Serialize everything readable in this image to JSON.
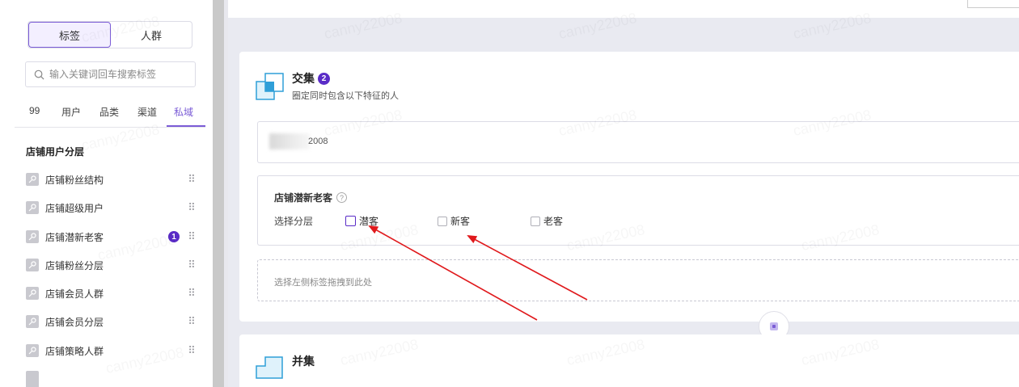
{
  "left_panel": {
    "segments": [
      {
        "label": "标签",
        "active": true
      },
      {
        "label": "人群",
        "active": false
      }
    ],
    "search": {
      "placeholder": "输入关键词回车搜索标签"
    },
    "tabs": [
      {
        "label": "99"
      },
      {
        "label": "用户"
      },
      {
        "label": "品类"
      },
      {
        "label": "渠道"
      },
      {
        "label": "私域",
        "active": true
      }
    ],
    "section_title": "店铺用户分层",
    "items": [
      {
        "label": "店铺粉丝结构"
      },
      {
        "label": "店铺超级用户"
      },
      {
        "label": "店铺潜新老客",
        "badge": "1"
      },
      {
        "label": "店铺粉丝分层"
      },
      {
        "label": "店铺会员人群"
      },
      {
        "label": "店铺会员分层"
      },
      {
        "label": "店铺策略人群"
      }
    ]
  },
  "intersection_card": {
    "title": "交集",
    "badge": "2",
    "subtitle": "圈定同时包含以下特征的人",
    "name_value_suffix": "2008",
    "condition": {
      "title": "店铺潜新老客",
      "help_icon": "?",
      "layer_label": "选择分层",
      "options": [
        {
          "label": "潜客",
          "checked": false,
          "highlighted": true
        },
        {
          "label": "新客",
          "checked": false
        },
        {
          "label": "老客",
          "checked": false
        }
      ]
    },
    "drop_zone_text": "选择左侧标签拖拽到此处"
  },
  "union_card": {
    "title": "并集"
  },
  "watermark_text": "canny22008",
  "colors": {
    "accent": "#7b5cd6",
    "badge": "#5a2cc7",
    "annotation_arrow": "#e0191c"
  }
}
